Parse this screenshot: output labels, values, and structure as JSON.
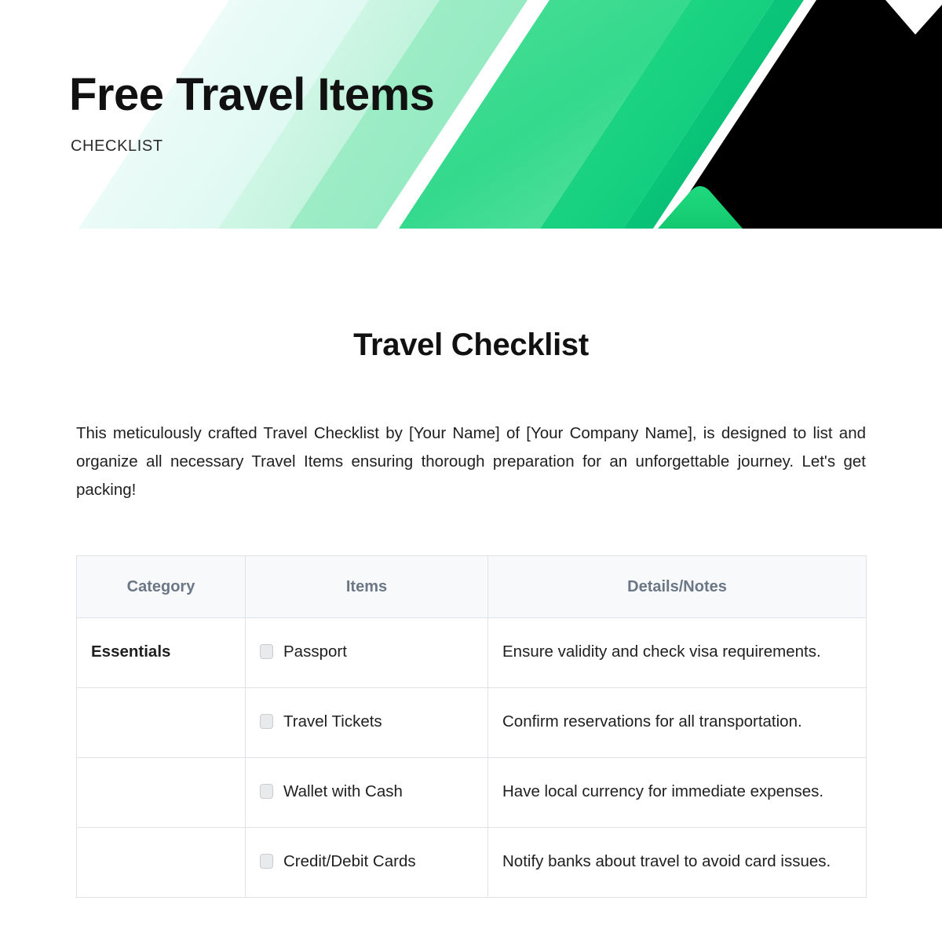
{
  "header": {
    "brand_title": "Free Travel Items",
    "brand_subtitle": "CHECKLIST",
    "accent_green": "#2ee07f",
    "deep_green": "#07c57a",
    "black": "#000000"
  },
  "document": {
    "title": "Travel Checklist",
    "intro": "This meticulously crafted Travel Checklist by [Your Name] of [Your Company Name], is designed to list and organize all necessary Travel Items ensuring thorough preparation for an unforgettable journey. Let's get packing!"
  },
  "table": {
    "columns": [
      "Category",
      "Items",
      "Details/Notes"
    ],
    "rows": [
      {
        "category": "Essentials",
        "item": "Passport",
        "notes": "Ensure validity and check visa requirements."
      },
      {
        "category": "",
        "item": "Travel Tickets",
        "notes": "Confirm reservations for all transportation."
      },
      {
        "category": "",
        "item": "Wallet with Cash",
        "notes": "Have local currency for immediate expenses."
      },
      {
        "category": "",
        "item": "Credit/Debit Cards",
        "notes": "Notify banks about travel to avoid card issues."
      }
    ]
  }
}
